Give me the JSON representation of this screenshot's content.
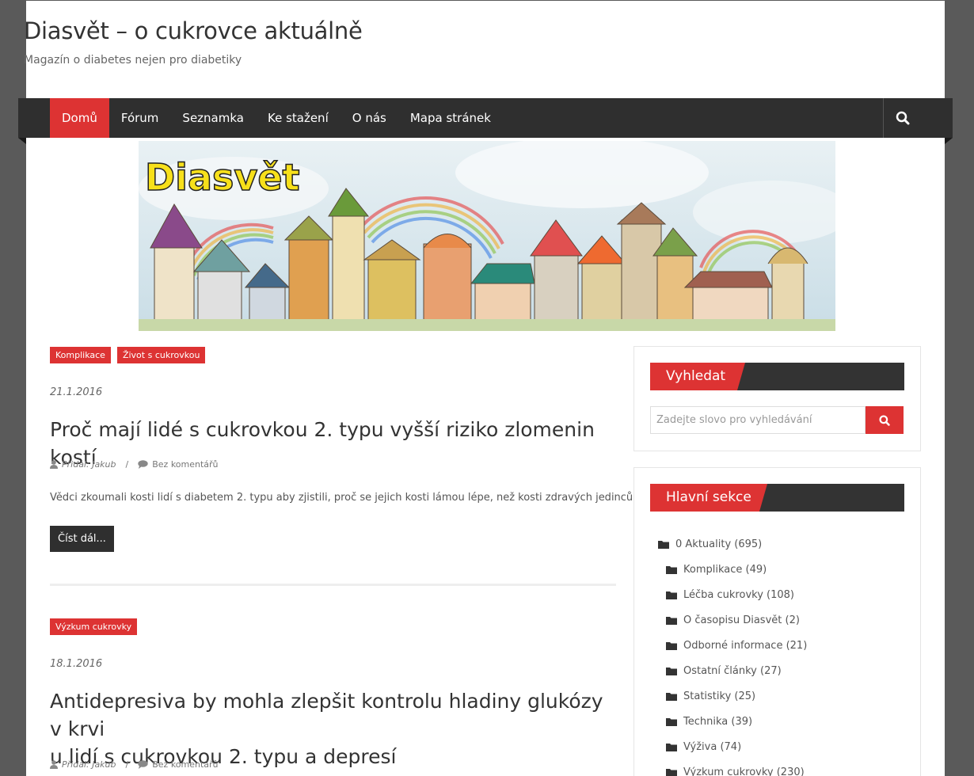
{
  "site": {
    "title": "Diasvět – o cukrovce aktuálně",
    "description": "Magazín o diabetes nejen pro diabetiky"
  },
  "nav": {
    "items": [
      "Domů",
      "Fórum",
      "Seznamka",
      "Ke stažení",
      "O nás",
      "Mapa stránek"
    ],
    "active": "Domů"
  },
  "banner": {
    "logo_text": "Diasvět"
  },
  "posts": [
    {
      "tags": [
        "Komplikace",
        "Život s cukrovkou"
      ],
      "date": "21.1.2016",
      "title": "Proč mají lidé s cukrovkou 2. typu vyšší riziko zlomenin kostí",
      "author": "Přidal: Jakub",
      "comments": "Bez komentářů",
      "excerpt": "Vědci zkoumali kosti lidí s diabetem 2. typu aby zjistili, proč se jejich kosti lámou lépe, než kosti zdravých jedinců.",
      "read_more": "Číst dál..."
    },
    {
      "tags": [
        "Výzkum cukrovky"
      ],
      "date": "18.1.2016",
      "title_line1": "Antidepresiva by mohla zlepšit kontrolu hladiny glukózy v krvi",
      "title_line2": "u lidí s cukrovkou 2. typu a depresí",
      "author": "Přidal: Jakub",
      "comments": "Bez komentářů"
    }
  ],
  "sidebar": {
    "search_widget": {
      "title": "Vyhledat",
      "placeholder": "Zadejte slovo pro vyhledávání"
    },
    "categories_widget": {
      "title": "Hlavní sekce",
      "items": [
        "0 Aktuality (695)",
        "Komplikace (49)",
        "Léčba cukrovky (108)",
        "O časopisu Diasvět (2)",
        "Odborné informace (21)",
        "Ostatní články (27)",
        "Statistiky (25)",
        "Technika (39)",
        "Výživa (74)",
        "Výzkum cukrovky (230)"
      ]
    }
  },
  "colors": {
    "accent": "#dd3333",
    "nav_bg": "#2f2f2f"
  }
}
